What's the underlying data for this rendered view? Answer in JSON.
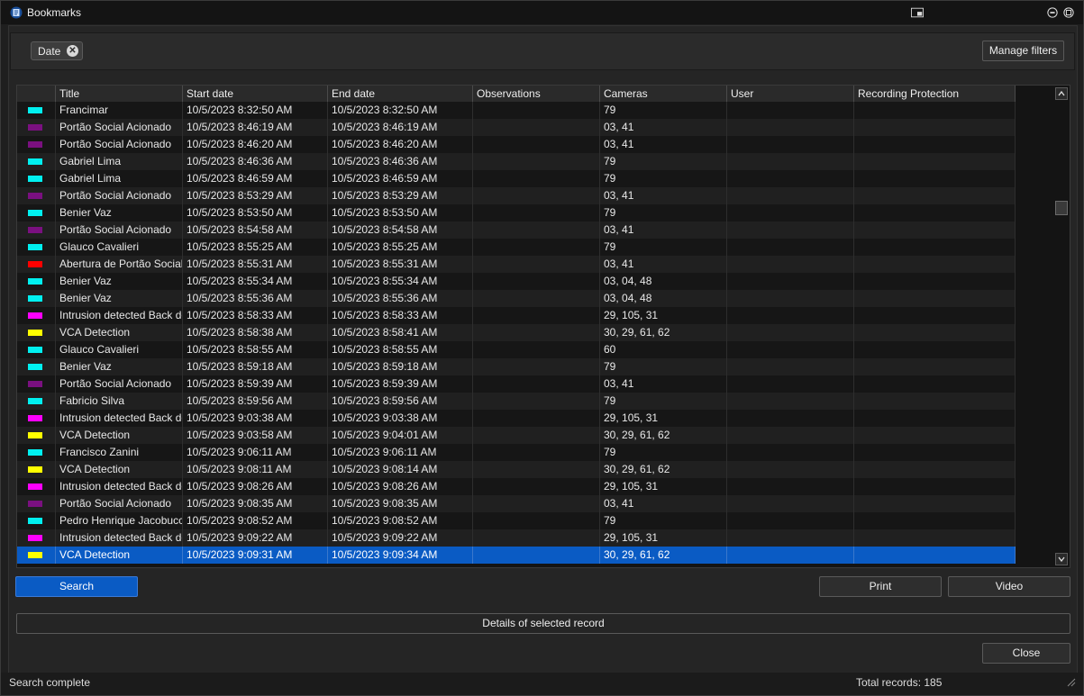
{
  "window": {
    "title": "Bookmarks"
  },
  "filters": {
    "chip_label": "Date",
    "manage_label": "Manage filters"
  },
  "table": {
    "columns": [
      "",
      "Title",
      "Start date",
      "End date",
      "Observations",
      "Cameras",
      "User",
      "Recording Protection"
    ],
    "rows": [
      {
        "color": "#00f0f0",
        "title": "Francimar",
        "start": "10/5/2023 8:32:50 AM",
        "end": "10/5/2023 8:32:50 AM",
        "observations": "",
        "cameras": "79",
        "user": "",
        "protection": ""
      },
      {
        "color": "#7a1080",
        "title": "Portão Social Acionado",
        "start": "10/5/2023 8:46:19 AM",
        "end": "10/5/2023 8:46:19 AM",
        "observations": "",
        "cameras": "03, 41",
        "user": "",
        "protection": ""
      },
      {
        "color": "#7a1080",
        "title": "Portão Social Acionado",
        "start": "10/5/2023 8:46:20 AM",
        "end": "10/5/2023 8:46:20 AM",
        "observations": "",
        "cameras": "03, 41",
        "user": "",
        "protection": ""
      },
      {
        "color": "#00f0f0",
        "title": "Gabriel Lima",
        "start": "10/5/2023 8:46:36 AM",
        "end": "10/5/2023 8:46:36 AM",
        "observations": "",
        "cameras": "79",
        "user": "",
        "protection": ""
      },
      {
        "color": "#00f0f0",
        "title": "Gabriel Lima",
        "start": "10/5/2023 8:46:59 AM",
        "end": "10/5/2023 8:46:59 AM",
        "observations": "",
        "cameras": "79",
        "user": "",
        "protection": ""
      },
      {
        "color": "#7a1080",
        "title": "Portão Social Acionado",
        "start": "10/5/2023 8:53:29 AM",
        "end": "10/5/2023 8:53:29 AM",
        "observations": "",
        "cameras": "03, 41",
        "user": "",
        "protection": ""
      },
      {
        "color": "#00f0f0",
        "title": "Benier Vaz",
        "start": "10/5/2023 8:53:50 AM",
        "end": "10/5/2023 8:53:50 AM",
        "observations": "",
        "cameras": "79",
        "user": "",
        "protection": ""
      },
      {
        "color": "#7a1080",
        "title": "Portão Social Acionado",
        "start": "10/5/2023 8:54:58 AM",
        "end": "10/5/2023 8:54:58 AM",
        "observations": "",
        "cameras": "03, 41",
        "user": "",
        "protection": ""
      },
      {
        "color": "#00f0f0",
        "title": "Glauco Cavalieri",
        "start": "10/5/2023 8:55:25 AM",
        "end": "10/5/2023 8:55:25 AM",
        "observations": "",
        "cameras": "79",
        "user": "",
        "protection": ""
      },
      {
        "color": "#ff0000",
        "title": "Abertura de Portão Social",
        "start": "10/5/2023 8:55:31 AM",
        "end": "10/5/2023 8:55:31 AM",
        "observations": "",
        "cameras": "03, 41",
        "user": "",
        "protection": ""
      },
      {
        "color": "#00f0f0",
        "title": "Benier Vaz",
        "start": "10/5/2023 8:55:34 AM",
        "end": "10/5/2023 8:55:34 AM",
        "observations": "",
        "cameras": "03, 04, 48",
        "user": "",
        "protection": ""
      },
      {
        "color": "#00f0f0",
        "title": "Benier Vaz",
        "start": "10/5/2023 8:55:36 AM",
        "end": "10/5/2023 8:55:36 AM",
        "observations": "",
        "cameras": "03, 04, 48",
        "user": "",
        "protection": ""
      },
      {
        "color": "#ff00ff",
        "title": "Intrusion detected Back door",
        "start": "10/5/2023 8:58:33 AM",
        "end": "10/5/2023 8:58:33 AM",
        "observations": "",
        "cameras": "29, 105, 31",
        "user": "",
        "protection": ""
      },
      {
        "color": "#ffff00",
        "title": "VCA Detection",
        "start": "10/5/2023 8:58:38 AM",
        "end": "10/5/2023 8:58:41 AM",
        "observations": "",
        "cameras": "30, 29, 61, 62",
        "user": "",
        "protection": ""
      },
      {
        "color": "#00f0f0",
        "title": "Glauco Cavalieri",
        "start": "10/5/2023 8:58:55 AM",
        "end": "10/5/2023 8:58:55 AM",
        "observations": "",
        "cameras": "60",
        "user": "",
        "protection": ""
      },
      {
        "color": "#00f0f0",
        "title": "Benier Vaz",
        "start": "10/5/2023 8:59:18 AM",
        "end": "10/5/2023 8:59:18 AM",
        "observations": "",
        "cameras": "79",
        "user": "",
        "protection": ""
      },
      {
        "color": "#7a1080",
        "title": "Portão Social Acionado",
        "start": "10/5/2023 8:59:39 AM",
        "end": "10/5/2023 8:59:39 AM",
        "observations": "",
        "cameras": "03, 41",
        "user": "",
        "protection": ""
      },
      {
        "color": "#00f0f0",
        "title": "Fabricio Silva",
        "start": "10/5/2023 8:59:56 AM",
        "end": "10/5/2023 8:59:56 AM",
        "observations": "",
        "cameras": "79",
        "user": "",
        "protection": ""
      },
      {
        "color": "#ff00ff",
        "title": "Intrusion detected Back door",
        "start": "10/5/2023 9:03:38 AM",
        "end": "10/5/2023 9:03:38 AM",
        "observations": "",
        "cameras": "29, 105, 31",
        "user": "",
        "protection": ""
      },
      {
        "color": "#ffff00",
        "title": "VCA Detection",
        "start": "10/5/2023 9:03:58 AM",
        "end": "10/5/2023 9:04:01 AM",
        "observations": "",
        "cameras": "30, 29, 61, 62",
        "user": "",
        "protection": ""
      },
      {
        "color": "#00f0f0",
        "title": "Francisco Zanini",
        "start": "10/5/2023 9:06:11 AM",
        "end": "10/5/2023 9:06:11 AM",
        "observations": "",
        "cameras": "79",
        "user": "",
        "protection": ""
      },
      {
        "color": "#ffff00",
        "title": "VCA Detection",
        "start": "10/5/2023 9:08:11 AM",
        "end": "10/5/2023 9:08:14 AM",
        "observations": "",
        "cameras": "30, 29, 61, 62",
        "user": "",
        "protection": ""
      },
      {
        "color": "#ff00ff",
        "title": "Intrusion detected Back door",
        "start": "10/5/2023 9:08:26 AM",
        "end": "10/5/2023 9:08:26 AM",
        "observations": "",
        "cameras": "29, 105, 31",
        "user": "",
        "protection": ""
      },
      {
        "color": "#7a1080",
        "title": "Portão Social Acionado",
        "start": "10/5/2023 9:08:35 AM",
        "end": "10/5/2023 9:08:35 AM",
        "observations": "",
        "cameras": "03, 41",
        "user": "",
        "protection": ""
      },
      {
        "color": "#00f0f0",
        "title": "Pedro Henrique Jacobucci",
        "start": "10/5/2023 9:08:52 AM",
        "end": "10/5/2023 9:08:52 AM",
        "observations": "",
        "cameras": "79",
        "user": "",
        "protection": ""
      },
      {
        "color": "#ff00ff",
        "title": "Intrusion detected Back door",
        "start": "10/5/2023 9:09:22 AM",
        "end": "10/5/2023 9:09:22 AM",
        "observations": "",
        "cameras": "29, 105, 31",
        "user": "",
        "protection": ""
      },
      {
        "color": "#ffff00",
        "title": "VCA Detection",
        "start": "10/5/2023 9:09:31 AM",
        "end": "10/5/2023 9:09:34 AM",
        "observations": "",
        "cameras": "30, 29, 61, 62",
        "user": "",
        "protection": "",
        "selected": true
      }
    ]
  },
  "buttons": {
    "search": "Search",
    "print": "Print",
    "video": "Video",
    "details": "Details of selected record",
    "close": "Close"
  },
  "status": {
    "left": "Search complete",
    "right": "Total records: 185"
  },
  "colors": {
    "accent": "#0a5bc4"
  }
}
